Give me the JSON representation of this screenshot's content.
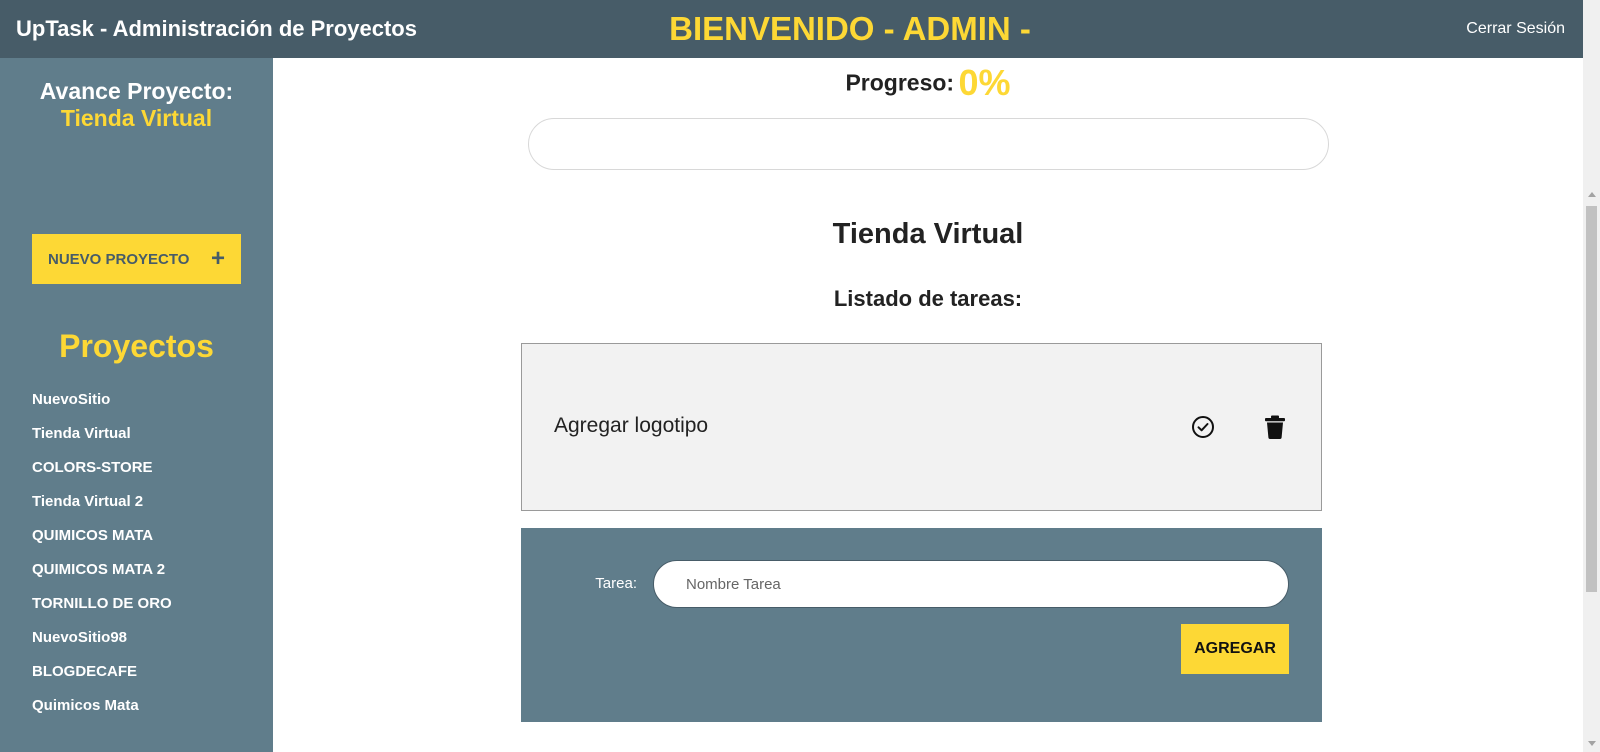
{
  "header": {
    "app_title": "UpTask - Administración de Proyectos",
    "welcome": "BIENVENIDO - ADMIN -",
    "logout": "Cerrar Sesión"
  },
  "sidebar": {
    "heading_prefix": "Avance Proyecto:",
    "heading_project": "Tienda Virtual",
    "new_project_label": "NUEVO PROYECTO",
    "new_project_icon": "plus-icon",
    "projects_title": "Proyectos",
    "projects": [
      "NuevoSitio",
      "Tienda Virtual",
      "COLORS-STORE",
      "Tienda Virtual 2",
      "QUIMICOS MATA",
      "QUIMICOS MATA 2",
      "TORNILLO DE ORO",
      "NuevoSitio98",
      "BLOGDECAFE",
      "Quimicos Mata"
    ]
  },
  "main": {
    "progress_label": "Progreso:",
    "progress_value": "0%",
    "progress_fraction": 0,
    "project_title": "Tienda Virtual",
    "tasks_heading": "Listado de tareas:",
    "tasks": [
      {
        "name": "Agregar logotipo",
        "complete_icon": "check-circle-icon",
        "delete_icon": "trash-icon"
      }
    ],
    "form": {
      "label": "Tarea:",
      "placeholder": "Nombre Tarea",
      "value": "",
      "submit": "AGREGAR"
    }
  },
  "colors": {
    "header_bg": "#475c68",
    "sidebar_bg": "#607d8b",
    "accent": "#fdd835"
  }
}
